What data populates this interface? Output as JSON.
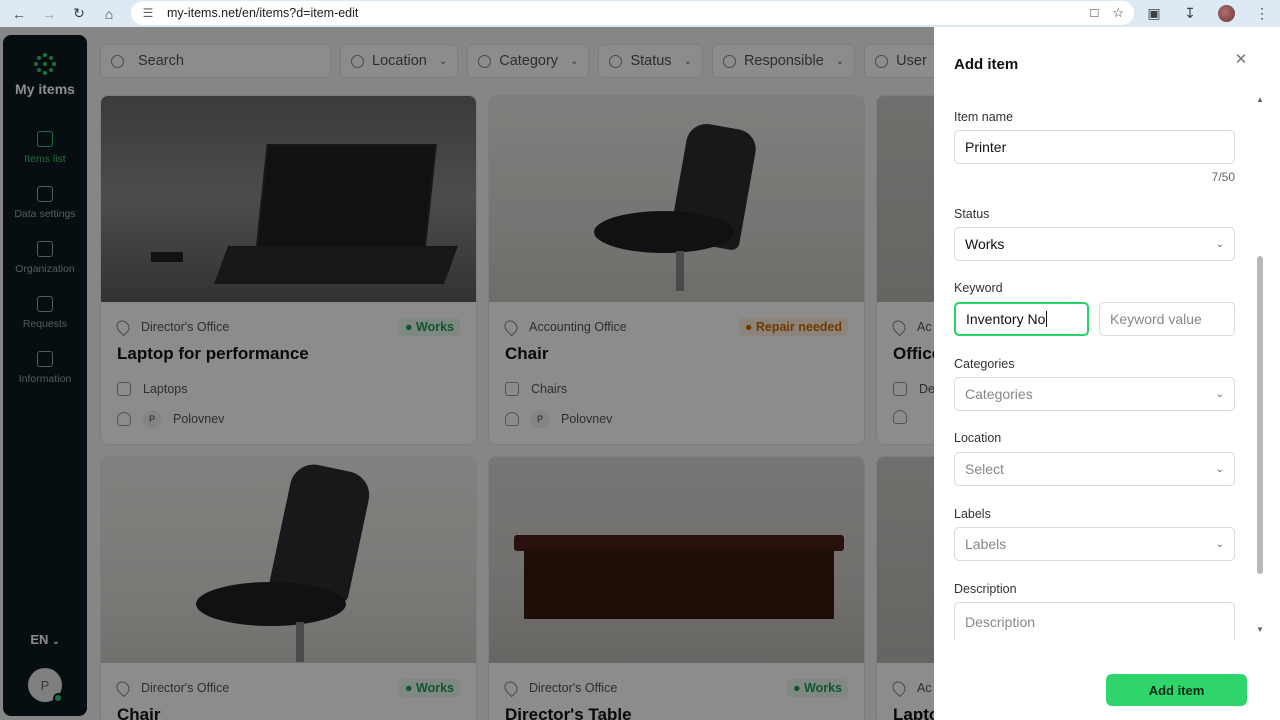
{
  "browser": {
    "url": "my-items.net/en/items?d=item-edit"
  },
  "sidebar": {
    "brand": "My items",
    "items": [
      {
        "label": "Items list",
        "icon": "list-icon",
        "active": true
      },
      {
        "label": "Data settings",
        "icon": "chart-icon",
        "active": false
      },
      {
        "label": "Organization",
        "icon": "building-icon",
        "active": false
      },
      {
        "label": "Requests",
        "icon": "requests-icon",
        "active": false
      },
      {
        "label": "Information",
        "icon": "document-icon",
        "active": false
      }
    ],
    "language": "EN",
    "avatar_initial": "P"
  },
  "filters": {
    "search_placeholder": "Search",
    "location": "Location",
    "category": "Category",
    "status": "Status",
    "responsible": "Responsible",
    "user": "User"
  },
  "cards": [
    {
      "location": "Director's Office",
      "status": "Works",
      "title": "Laptop for performance",
      "category": "Laptops",
      "responsible_initial": "P",
      "responsible": "Polovnev"
    },
    {
      "location": "Accounting Office",
      "status": "Repair needed",
      "title": "Chair",
      "category": "Chairs",
      "responsible_initial": "P",
      "responsible": "Polovnev"
    },
    {
      "location": "Ac",
      "title": "Office",
      "category": "De"
    },
    {
      "location": "Director's Office",
      "status": "Works",
      "title": "Chair"
    },
    {
      "location": "Director's Office",
      "status": "Works",
      "title": "Director's Table"
    },
    {
      "location": "Ac",
      "title": "Lapto"
    }
  ],
  "panel": {
    "title": "Add item",
    "item_name_label": "Item name",
    "item_name_value": "Printer",
    "item_name_counter": "7/50",
    "status_label": "Status",
    "status_value": "Works",
    "keyword_label": "Keyword",
    "keyword_value": "Inventory No",
    "keyword_value_placeholder": "Keyword value",
    "categories_label": "Categories",
    "categories_placeholder": "Categories",
    "location_label": "Location",
    "location_placeholder": "Select",
    "labels_label": "Labels",
    "labels_placeholder": "Labels",
    "description_label": "Description",
    "description_placeholder": "Description",
    "submit_label": "Add item"
  },
  "colors": {
    "accent": "#2ed56b",
    "sidebar_bg": "#0d1b20",
    "status_ok": "#1f9d55",
    "status_repair": "#c96a00"
  }
}
